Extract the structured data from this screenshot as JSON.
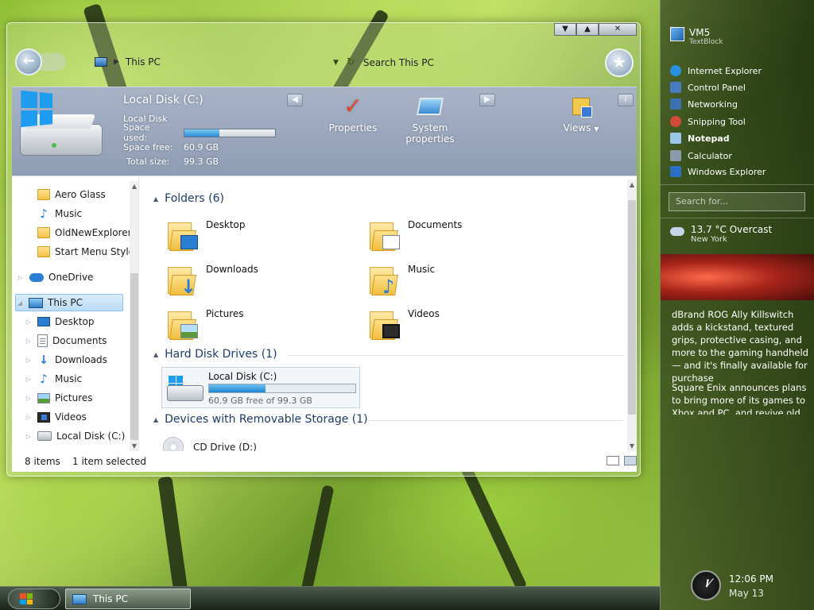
{
  "window": {
    "address": {
      "location": "This PC"
    },
    "search": {
      "placeholder": "Search This PC"
    },
    "caption": {
      "minimize": "▼",
      "maximize": "▲",
      "close": "✕"
    }
  },
  "info_pane": {
    "title": "Local Disk (C:)",
    "subtitle": "Local Disk",
    "space_used_label": "Space used:",
    "space_used_fraction": 0.387,
    "space_free_label": "Space free:",
    "space_free_value": "60.9 GB",
    "total_size_label": "Total size:",
    "total_size_value": "99.3 GB",
    "actions": {
      "properties": "Properties",
      "system_properties": "System properties",
      "views": "Views"
    }
  },
  "nav_pane": {
    "quick": [
      "Aero Glass",
      "Music",
      "OldNewExplorer",
      "Start Menu Style"
    ],
    "onedrive": "OneDrive",
    "this_pc": "This PC",
    "this_pc_children": [
      "Desktop",
      "Documents",
      "Downloads",
      "Music",
      "Pictures",
      "Videos",
      "Local Disk (C:)"
    ]
  },
  "main_pane": {
    "folders_header": "Folders (6)",
    "folders": [
      "Desktop",
      "Documents",
      "Downloads",
      "Music",
      "Pictures",
      "Videos"
    ],
    "hdd_header": "Hard Disk Drives (1)",
    "drive": {
      "name": "Local Disk (C:)",
      "free_text": "60.9 GB free of 99.3 GB",
      "used_fraction": 0.387
    },
    "removable_header": "Devices with Removable Storage (1)",
    "cd": "CD Drive (D:)"
  },
  "status": {
    "count": "8 items",
    "selected": "1 item selected"
  },
  "sidebar": {
    "title": "VM5",
    "subtitle": "TextBlock",
    "links": [
      "Internet Explorer",
      "Control Panel",
      "Networking",
      "Snipping Tool",
      "Notepad",
      "Calculator",
      "Windows Explorer"
    ],
    "search_placeholder": "Search for...",
    "weather": {
      "temp": "13.7 °C Overcast",
      "city": "New York"
    },
    "news": [
      "dBrand ROG Ally Killswitch adds a kickstand, textured grips, protective casing, and more to the gaming handheld — and it's finally available for purchase",
      "Square Enix announces plans to bring more of its games to Xbox and PC, and revive old franchises"
    ],
    "time": "12:06 PM",
    "date": "May 13"
  },
  "taskbar": {
    "task": "This PC"
  },
  "colors": {
    "accent": "#1e9cf0",
    "header_text": "#1e3a6e",
    "close_check": "#e8452b"
  }
}
